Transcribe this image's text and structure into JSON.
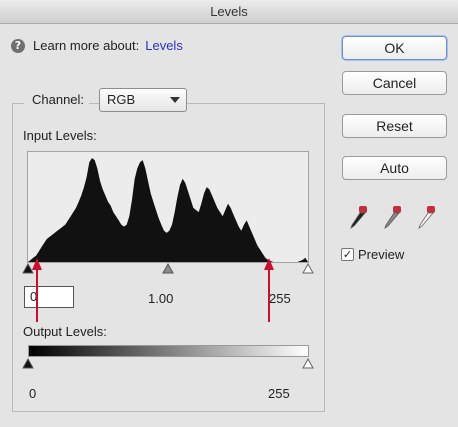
{
  "window": {
    "title": "Levels"
  },
  "learn": {
    "text": "Learn more about:",
    "link": "Levels",
    "icon": "help-circle-icon"
  },
  "channel": {
    "label": "Channel:",
    "value": "RGB"
  },
  "input_levels": {
    "label": "Input Levels:",
    "black": "0",
    "gamma": "1.00",
    "white": "255",
    "histogram": [
      0,
      2,
      4,
      6,
      10,
      14,
      18,
      22,
      24,
      26,
      28,
      30,
      32,
      34,
      36,
      40,
      44,
      48,
      52,
      58,
      64,
      72,
      82,
      96,
      100,
      98,
      90,
      78,
      70,
      64,
      58,
      54,
      48,
      44,
      40,
      36,
      34,
      36,
      44,
      60,
      80,
      90,
      96,
      98,
      90,
      78,
      66,
      58,
      50,
      42,
      36,
      30,
      28,
      30,
      36,
      48,
      62,
      74,
      80,
      76,
      68,
      60,
      52,
      50,
      48,
      56,
      66,
      72,
      70,
      64,
      58,
      52,
      48,
      44,
      50,
      56,
      52,
      46,
      40,
      34,
      30,
      36,
      40,
      34,
      28,
      22,
      16,
      12,
      8,
      4,
      2,
      1,
      0,
      0,
      0,
      0,
      0,
      0,
      0,
      0,
      0,
      0,
      1,
      2,
      4,
      0
    ]
  },
  "output_levels": {
    "label": "Output Levels:",
    "black": "0",
    "white": "255"
  },
  "buttons": {
    "ok": "OK",
    "cancel": "Cancel",
    "reset": "Reset",
    "auto": "Auto"
  },
  "preview": {
    "label": "Preview",
    "checked": true
  },
  "annotations": {
    "arrow_color": "#c8102e"
  }
}
